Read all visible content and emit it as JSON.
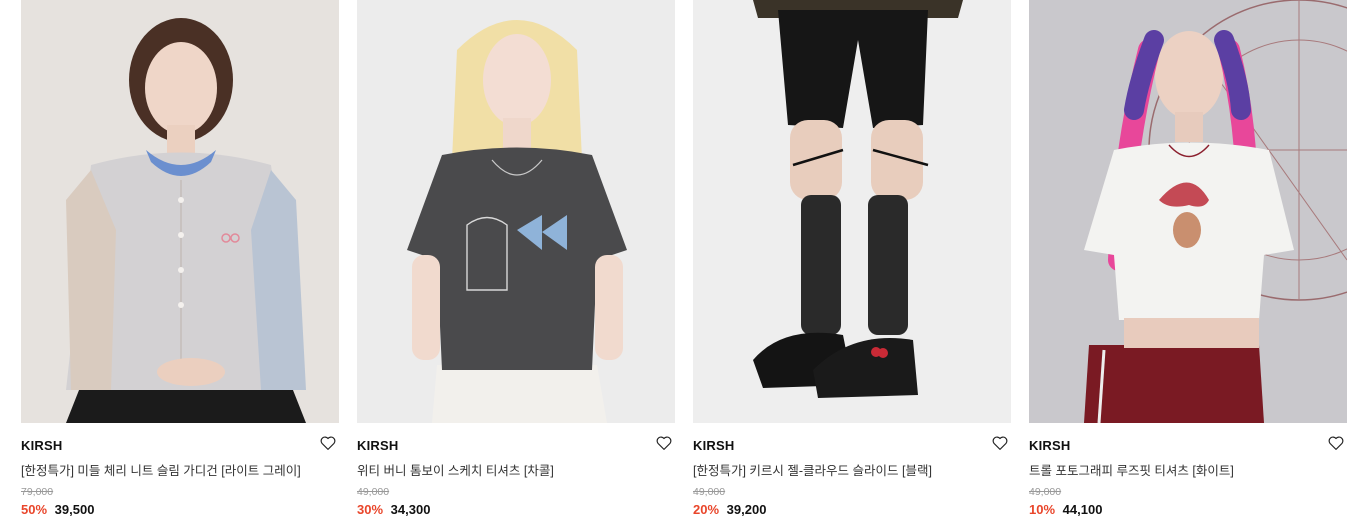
{
  "products": [
    {
      "brand": "KIRSH",
      "title": "[한정특가] 미들 체리 니트 슬림 가디건 [라이트 그레이]",
      "original_price": "79,000",
      "discount": "50%",
      "sale_price": "39,500",
      "bg": "#e6e2de"
    },
    {
      "brand": "KIRSH",
      "title": "위티 버니 톰보이 스케치 티셔츠 [차콜]",
      "original_price": "49,000",
      "discount": "30%",
      "sale_price": "34,300",
      "bg": "#ececec"
    },
    {
      "brand": "KIRSH",
      "title": "[한정특가] 키르시 젤-클라우드 슬라이드 [블랙]",
      "original_price": "49,000",
      "discount": "20%",
      "sale_price": "39,200",
      "bg": "#eeeeee"
    },
    {
      "brand": "KIRSH",
      "title": "트롤 포토그래피 루즈핏 티셔츠 [화이트]",
      "original_price": "49,000",
      "discount": "10%",
      "sale_price": "44,100",
      "bg": "#c9c8cc"
    }
  ],
  "colors": {
    "discount": "#e9462b",
    "text": "#111111",
    "muted": "#999999"
  },
  "icons": {
    "wishlist": "heart-icon"
  }
}
